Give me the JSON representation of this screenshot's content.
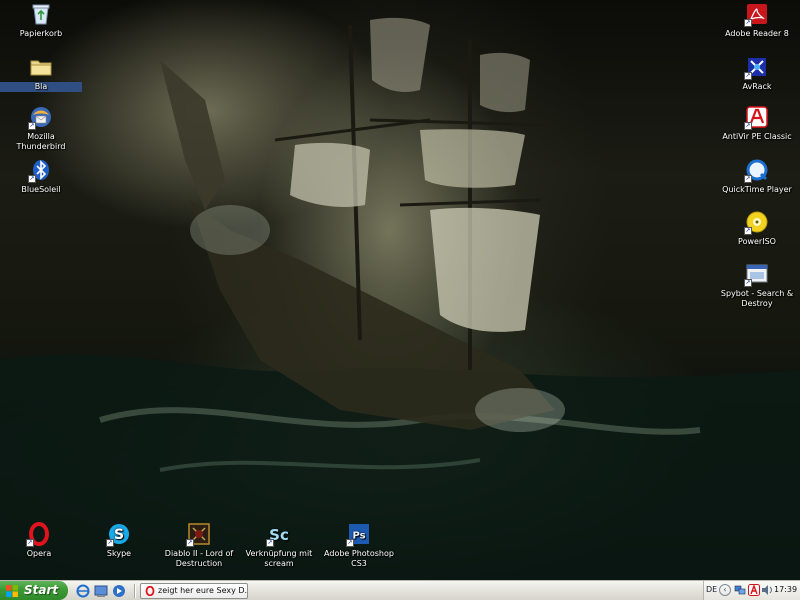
{
  "desktop": {
    "left_icons": [
      {
        "label": "Papierkorb",
        "icon": "recycle-bin-icon"
      },
      {
        "label": "Bla",
        "icon": "folder-icon"
      },
      {
        "label": "Mozilla Thunderbird",
        "icon": "thunderbird-icon"
      },
      {
        "label": "BlueSoleil",
        "icon": "bluetooth-icon"
      }
    ],
    "right_icons": [
      {
        "label": "Adobe Reader 8",
        "icon": "adobe-reader-icon"
      },
      {
        "label": "AvRack",
        "icon": "avrack-icon"
      },
      {
        "label": "AntiVir PE Classic",
        "icon": "antivir-icon"
      },
      {
        "label": "QuickTime Player",
        "icon": "quicktime-icon"
      },
      {
        "label": "PowerISO",
        "icon": "poweriso-icon"
      },
      {
        "label": "Spybot - Search & Destroy",
        "icon": "spybot-icon"
      }
    ],
    "bottom_icons": [
      {
        "label": "Opera",
        "icon": "opera-icon"
      },
      {
        "label": "Skype",
        "icon": "skype-icon"
      },
      {
        "label": "Diablo II - Lord of Destruction",
        "icon": "diablo-icon"
      },
      {
        "label": "Verknüpfung mit scream",
        "icon": "scream-icon"
      },
      {
        "label": "Adobe Photoshop CS3",
        "icon": "photoshop-icon"
      }
    ]
  },
  "taskbar": {
    "start_label": "Start",
    "quick_launch": [
      "ie-icon",
      "show-desktop-icon",
      "media-player-icon"
    ],
    "window_button": "zeigt her eure Sexy D...",
    "tray": {
      "language": "DE",
      "clock": "17:39",
      "icons": [
        "network-icon",
        "antivir-tray-icon",
        "volume-icon"
      ]
    }
  },
  "colors": {
    "start_green": "#3c9a36",
    "taskbar_bg": "#e7e6df",
    "acrobat_red": "#c8161d",
    "antivir_red": "#d7141a",
    "photoshop_blue": "#1d5bb3"
  }
}
